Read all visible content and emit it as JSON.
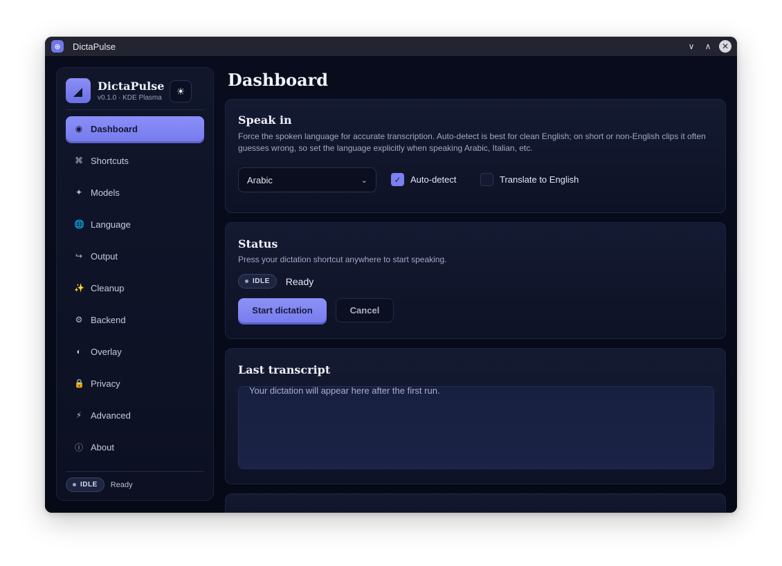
{
  "window": {
    "title": "DictaPulse"
  },
  "brand": {
    "name": "DictaPulse",
    "version": "v0.1.0 · KDE Plasma"
  },
  "nav": [
    {
      "label": "Dashboard",
      "icon": "◉",
      "icon_name": "dashboard-icon",
      "active": true
    },
    {
      "label": "Shortcuts",
      "icon": "⌘",
      "icon_name": "command-icon"
    },
    {
      "label": "Models",
      "icon": "✦",
      "icon_name": "sparkle-icon"
    },
    {
      "label": "Language",
      "icon": "🌐",
      "icon_name": "globe-icon"
    },
    {
      "label": "Output",
      "icon": "↪",
      "icon_name": "output-arrow-icon"
    },
    {
      "label": "Cleanup",
      "icon": "✨",
      "icon_name": "sparkles-icon"
    },
    {
      "label": "Backend",
      "icon": "⚙",
      "icon_name": "gear-icon"
    },
    {
      "label": "Overlay",
      "icon": "◐",
      "icon_name": "half-circle-icon"
    },
    {
      "label": "Privacy",
      "icon": "🔒",
      "icon_name": "lock-icon"
    },
    {
      "label": "Advanced",
      "icon": "⚡",
      "icon_name": "lightning-icon"
    },
    {
      "label": "About",
      "icon": "ⓘ",
      "icon_name": "info-icon"
    }
  ],
  "sidebar_status": {
    "badge": "IDLE",
    "text": "Ready"
  },
  "page": {
    "title": "Dashboard"
  },
  "speak_in": {
    "title": "Speak in",
    "description": "Force the spoken language for accurate transcription. Auto-detect is best for clean English; on short or non-English clips it often guesses wrong, so set the language explicitly when speaking Arabic, Italian, etc.",
    "language": "Arabic",
    "auto_detect": {
      "label": "Auto-detect",
      "checked": true
    },
    "translate": {
      "label": "Translate to English",
      "checked": false
    }
  },
  "status": {
    "title": "Status",
    "description": "Press your dictation shortcut anywhere to start speaking.",
    "badge": "IDLE",
    "text": "Ready",
    "start_label": "Start dictation",
    "cancel_label": "Cancel"
  },
  "transcript": {
    "title": "Last transcript",
    "placeholder": "Your dictation will appear here after the first run."
  },
  "colors": {
    "accent": "#7b80ee",
    "background": "#070b1a"
  }
}
